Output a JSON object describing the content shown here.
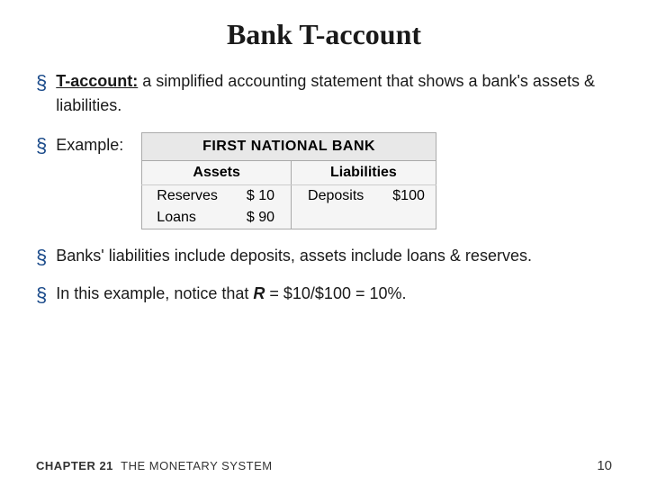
{
  "title": "Bank T-account",
  "bullet1": {
    "term": "T-account:",
    "rest": " a simplified accounting statement that shows a bank's assets & liabilities."
  },
  "bullet2": {
    "label": "Example:"
  },
  "t_account": {
    "bank_name": "FIRST NATIONAL BANK",
    "assets_header": "Assets",
    "liabilities_header": "Liabilities",
    "rows": [
      {
        "label": "Reserves",
        "assets_val": "$ 10",
        "liabilities_label": "Deposits",
        "liabilities_val": "$100"
      },
      {
        "label": "Loans",
        "assets_val": "$ 90",
        "liabilities_label": "",
        "liabilities_val": ""
      }
    ]
  },
  "bullet3": {
    "text": "Banks' liabilities include deposits, assets include loans & reserves."
  },
  "bullet4": {
    "prefix": "In this example, notice that ",
    "r_var": "R",
    "suffix": " = $10/$100 = 10%."
  },
  "footer": {
    "chapter": "CHAPTER 21",
    "subtitle": "THE MONETARY SYSTEM",
    "page": "10"
  }
}
